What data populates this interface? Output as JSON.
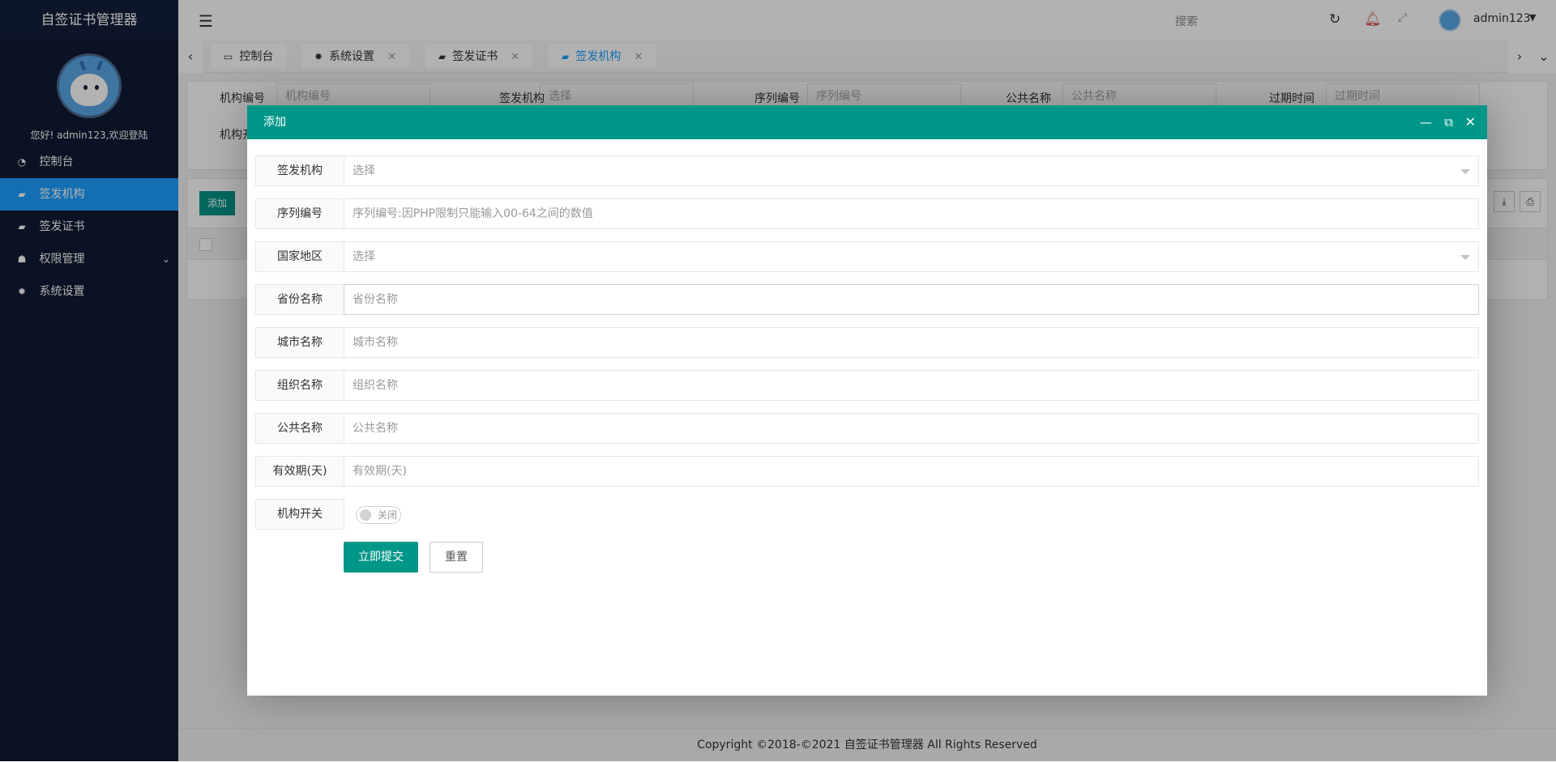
{
  "app": {
    "title": "自签证书管理器"
  },
  "sidebar": {
    "welcome": "您好! admin123,欢迎登陆",
    "items": [
      {
        "label": "控制台",
        "icon": "dashboard-icon",
        "glyph": "◔"
      },
      {
        "label": "签发机构",
        "icon": "book-icon",
        "glyph": "▰"
      },
      {
        "label": "签发证书",
        "icon": "book-icon",
        "glyph": "▰"
      },
      {
        "label": "权限管理",
        "icon": "users-icon",
        "glyph": "☗"
      },
      {
        "label": "系统设置",
        "icon": "gear-icon",
        "glyph": "✹"
      }
    ],
    "active_index": 1
  },
  "header": {
    "search_label": "搜索",
    "username": "admin123"
  },
  "tabs": [
    {
      "label": "控制台",
      "icon": "monitor-icon",
      "glyph": "▭"
    },
    {
      "label": "系统设置",
      "icon": "gear-icon",
      "glyph": "✹"
    },
    {
      "label": "签发证书",
      "icon": "book-icon",
      "glyph": "▰"
    },
    {
      "label": "签发机构",
      "icon": "book-icon",
      "glyph": "▰"
    }
  ],
  "background_page": {
    "filters": [
      "机构编号",
      "签发机构",
      "序列编号",
      "公共名称",
      "过期时间",
      "机构开"
    ],
    "placeholders": [
      "机构编号",
      "选择",
      "序列编号",
      "公共名称",
      "过期时间"
    ],
    "add_label": "添加"
  },
  "modal": {
    "title": "添加",
    "fields": [
      {
        "label": "签发机构",
        "type": "select",
        "placeholder": "选择"
      },
      {
        "label": "序列编号",
        "type": "text",
        "placeholder": "序列编号:因PHP限制只能输入00-64之间的数值"
      },
      {
        "label": "国家地区",
        "type": "select",
        "placeholder": "选择"
      },
      {
        "label": "省份名称",
        "type": "text",
        "placeholder": "省份名称"
      },
      {
        "label": "城市名称",
        "type": "text",
        "placeholder": "城市名称"
      },
      {
        "label": "组织名称",
        "type": "text",
        "placeholder": "组织名称"
      },
      {
        "label": "公共名称",
        "type": "text",
        "placeholder": "公共名称"
      },
      {
        "label": "有效期(天)",
        "type": "text",
        "placeholder": "有效期(天)"
      }
    ],
    "switch_label": "机构开关",
    "switch_text": "关闭",
    "submit_label": "立即提交",
    "reset_label": "重置"
  },
  "footer": {
    "text": "Copyright ©2018-©2021 自签证书管理器 All Rights Reserved"
  },
  "colors": {
    "sidebar_bg": "#0f1a33",
    "accent": "#009688",
    "active_nav": "#1e9fff"
  }
}
